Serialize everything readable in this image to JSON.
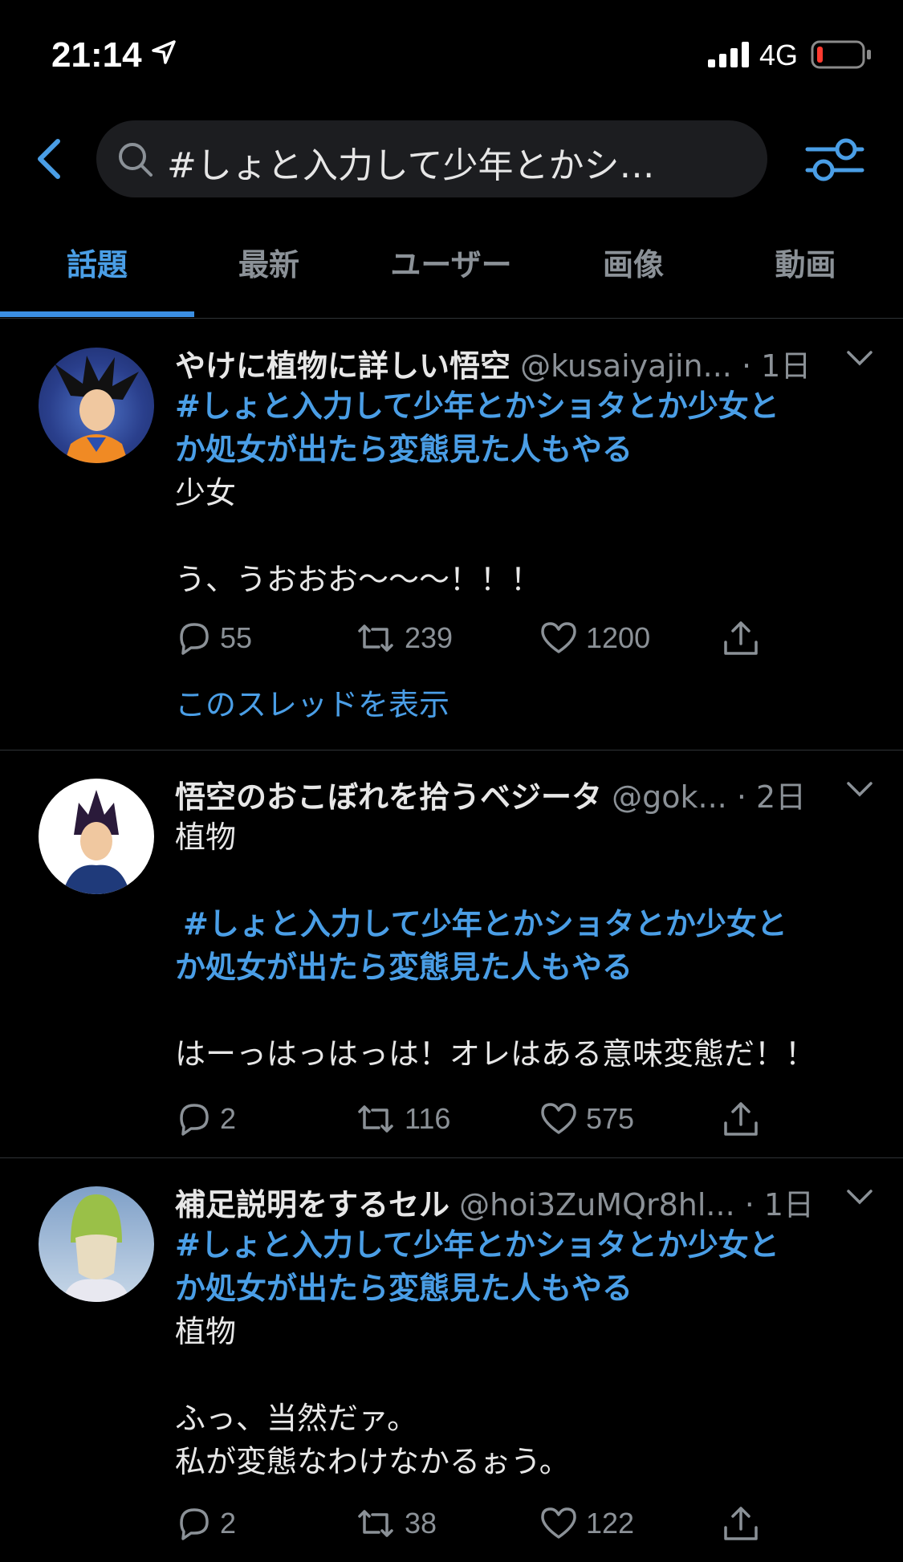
{
  "status": {
    "time": "21:14",
    "network": "4G"
  },
  "search": {
    "query": "#しょと入力して少年とかシ…"
  },
  "tabs": [
    "話題",
    "最新",
    "ユーザー",
    "画像",
    "動画"
  ],
  "tweets": [
    {
      "name": "やけに植物に詳しい悟空",
      "handle": "@kusaiyajin...",
      "time": "· 1日",
      "lines": [
        "#しょと入力して少年とかショタとか少女と",
        "か処女が出たら変態見た人もやる",
        "少女",
        "",
        "う、うおおお〜〜〜！！！"
      ],
      "replies": "55",
      "retweets": "239",
      "likes": "1200",
      "thread_link": "このスレッドを表示"
    },
    {
      "name": "悟空のおこぼれを拾うベジータ",
      "handle": "@gok...",
      "time": "· 2日",
      "lines": [
        "植物",
        "",
        "#しょと入力して少年とかショタとか少女と",
        "か処女が出たら変態見た人もやる",
        "",
        "はーっはっはっは！オレはある意味変態だ！！"
      ],
      "replies": "2",
      "retweets": "116",
      "likes": "575"
    },
    {
      "name": "補足説明をするセル",
      "handle": "@hoi3ZuMQr8hl...",
      "time": "· 1日",
      "lines": [
        "#しょと入力して少年とかショタとか少女と",
        "か処女が出たら変態見た人もやる",
        "植物",
        "",
        "ふっ、当然だァ。",
        "私が変態なわけなかるぉう。"
      ],
      "replies": "2",
      "retweets": "38",
      "likes": "122"
    }
  ],
  "colors": {
    "accent": "#4a9ee6",
    "muted": "#8b9197",
    "background": "#000000"
  }
}
